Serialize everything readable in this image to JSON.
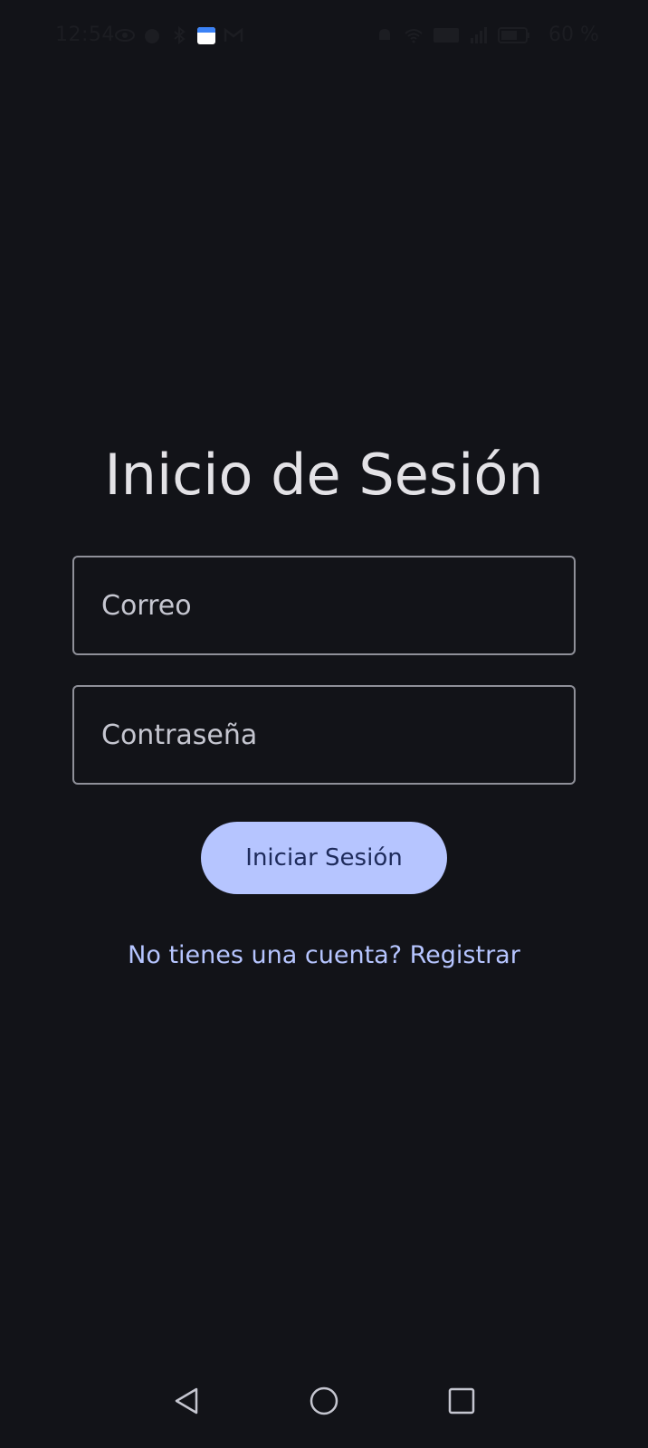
{
  "status_bar": {
    "time": "12:54",
    "battery_percent": "60 %",
    "left_icons": [
      "eye-icon",
      "alarm-icon",
      "bluetooth-icon",
      "calendar-app-icon",
      "gmail-icon"
    ],
    "right_icons": [
      "mute-icon",
      "wifi-icon",
      "volte-icon",
      "signal-icon",
      "battery-icon"
    ]
  },
  "login": {
    "title": "Inicio de Sesión",
    "email_placeholder": "Correo",
    "email_value": "",
    "password_placeholder": "Contraseña",
    "password_value": "",
    "submit_label": "Iniciar Sesión",
    "register_link": "No tienes una cuenta? Registrar"
  },
  "nav_bar": {
    "icons": [
      "back-icon",
      "home-icon",
      "recents-icon"
    ]
  },
  "colors": {
    "background": "#121318",
    "accent": "#b6c5ff",
    "on_accent": "#1e2b5b",
    "text": "#e3e2e6",
    "outline": "#8f9099"
  }
}
